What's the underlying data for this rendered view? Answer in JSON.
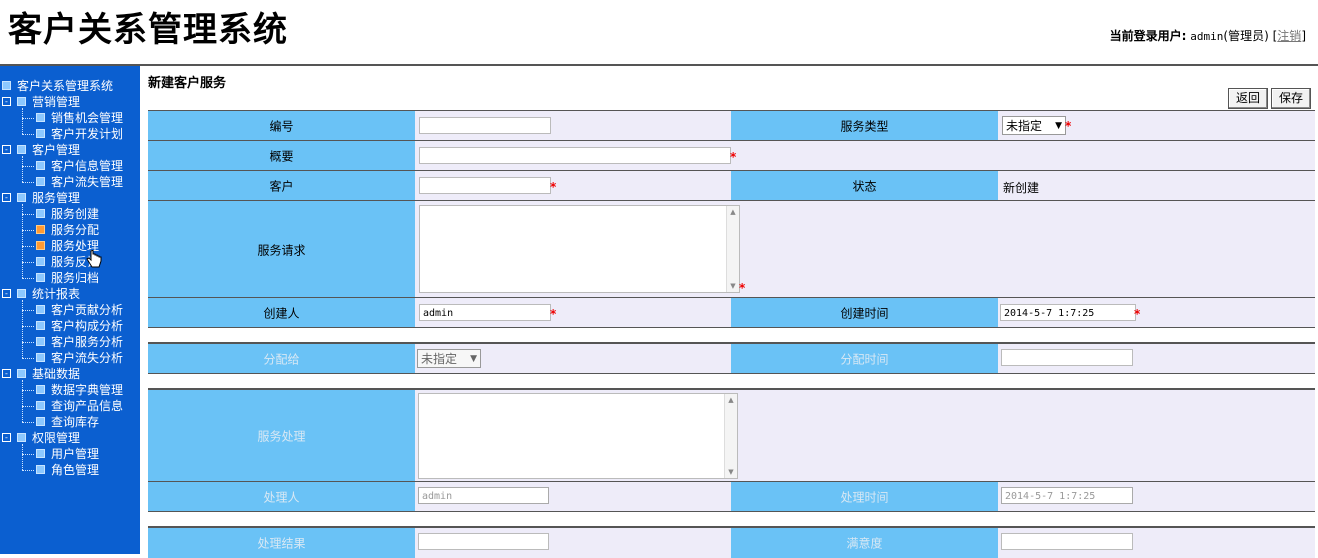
{
  "app": {
    "title": "客户关系管理系统",
    "user_label": "当前登录用户:",
    "user_name": "admin",
    "user_role": "(管理员)",
    "logout_open": " [",
    "logout_label": "注销",
    "logout_close": "]"
  },
  "sidebar": {
    "root": "客户关系管理系统",
    "groups": [
      {
        "label": "营销管理",
        "items": [
          "销售机会管理",
          "客户开发计划"
        ]
      },
      {
        "label": "客户管理",
        "items": [
          "客户信息管理",
          "客户流失管理"
        ]
      },
      {
        "label": "服务管理",
        "items": [
          "服务创建",
          "服务分配",
          "服务处理",
          "服务反馈",
          "服务归档"
        ]
      },
      {
        "label": "统计报表",
        "items": [
          "客户贡献分析",
          "客户构成分析",
          "客户服务分析",
          "客户流失分析"
        ]
      },
      {
        "label": "基础数据",
        "items": [
          "数据字典管理",
          "查询产品信息",
          "查询库存"
        ]
      },
      {
        "label": "权限管理",
        "items": [
          "用户管理",
          "角色管理"
        ]
      }
    ]
  },
  "form": {
    "title": "新建客户服务",
    "back_label": "返回",
    "save_label": "保存",
    "labels": {
      "id": "编号",
      "service_type": "服务类型",
      "summary": "概要",
      "customer": "客户",
      "status": "状态",
      "request": "服务请求",
      "creator": "创建人",
      "created_time": "创建时间",
      "assign_to": "分配给",
      "assign_time": "分配时间",
      "handle": "服务处理",
      "handler": "处理人",
      "handle_time": "处理时间",
      "result": "处理结果",
      "satisfaction": "满意度"
    },
    "values": {
      "service_type": "未指定",
      "status": "新创建",
      "creator": "admin",
      "created_time": "2014-5-7 1:7:25",
      "assign_to": "未指定",
      "handler": "admin",
      "handle_time": "2014-5-7 1:7:25"
    },
    "required_mark": "*"
  }
}
